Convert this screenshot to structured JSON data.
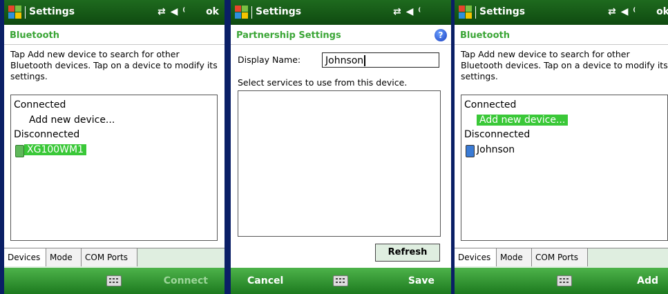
{
  "colors": {
    "titlebar": "#1a5e1a",
    "accent_green": "#3aa535",
    "selection": "#3ac838",
    "softkey_bar": "#2e8f2e",
    "separator": "#0a1f66"
  },
  "screens": [
    {
      "title": "Settings",
      "status_icons": "⇄ ◀ ⁽",
      "ok_label": "ok",
      "header": "Bluetooth",
      "description": "Tap Add new device to search for other Bluetooth devices. Tap on a device to modify its settings.",
      "list": {
        "connected_label": "Connected",
        "add_device_label": "Add new device...",
        "disconnected_label": "Disconnected",
        "device_name": "XG100WM1"
      },
      "tabs": [
        "Devices",
        "Mode",
        "COM Ports"
      ],
      "softkeys": {
        "right": "Connect"
      }
    },
    {
      "title": "Settings",
      "status_icons": "⇄ ◀ ⁽",
      "header": "Partnership Settings",
      "help_icon_label": "?",
      "display_name_label": "Display Name:",
      "display_name_value": "Johnson",
      "services_label": "Select services to use from this device.",
      "refresh_label": "Refresh",
      "softkeys": {
        "left": "Cancel",
        "right": "Save"
      }
    },
    {
      "title": "Settings",
      "status_icons": "⇄ ◀ ⁽",
      "ok_label": "ok",
      "header": "Bluetooth",
      "description": "Tap Add new device to search for other Bluetooth devices. Tap on a device to modify its settings.",
      "list": {
        "connected_label": "Connected",
        "add_device_label": "Add new device...",
        "disconnected_label": "Disconnected",
        "device_name": "Johnson"
      },
      "tabs": [
        "Devices",
        "Mode",
        "COM Ports"
      ],
      "softkeys": {
        "right": "Add"
      }
    }
  ]
}
